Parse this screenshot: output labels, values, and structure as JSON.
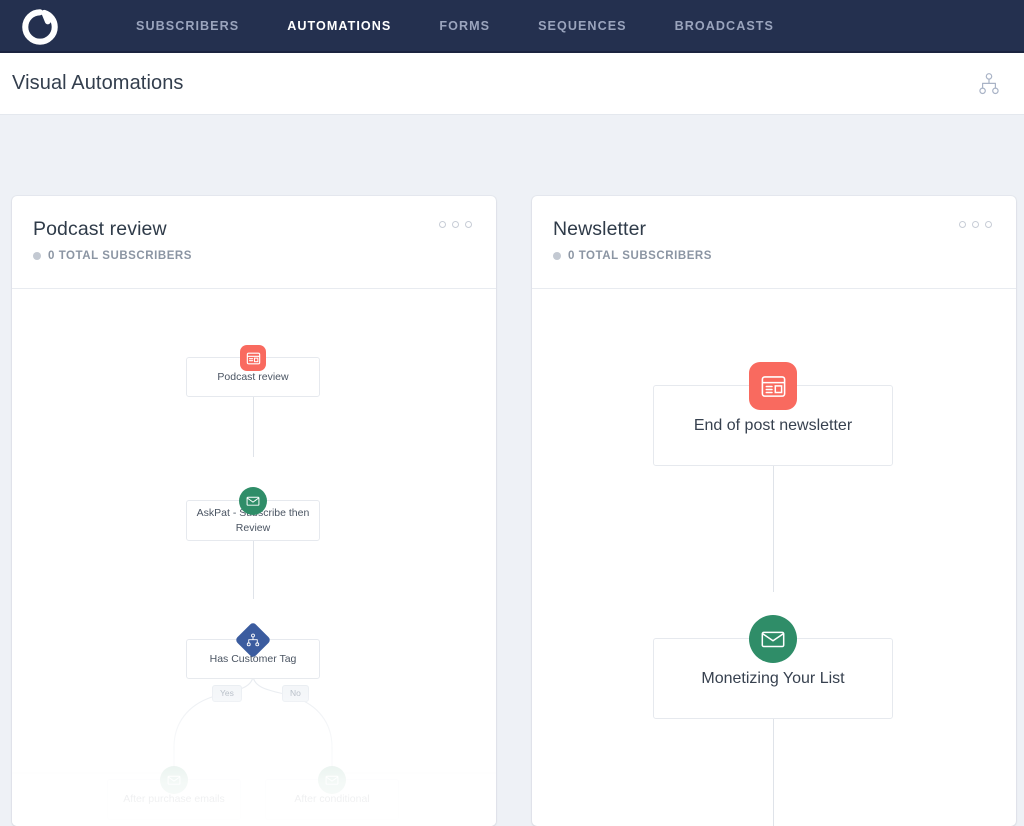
{
  "nav": {
    "logo_icon": "convertkit-logo-icon",
    "items": [
      {
        "label": "SUBSCRIBERS",
        "active": false
      },
      {
        "label": "AUTOMATIONS",
        "active": true
      },
      {
        "label": "FORMS",
        "active": false
      },
      {
        "label": "SEQUENCES",
        "active": false
      },
      {
        "label": "BROADCASTS",
        "active": false
      }
    ],
    "background": "#24304f",
    "active_color": "#ffffff",
    "inactive_color": "#9aa4bd"
  },
  "header": {
    "title": "Visual Automations",
    "tree_icon": "node-tree-icon"
  },
  "colors": {
    "page_background": "#eef1f6",
    "form_badge": "#f96a5f",
    "email_badge": "#2f8d68",
    "condition_badge": "#3b5c9f",
    "connector": "#dfe3e9"
  },
  "cards": [
    {
      "title": "Podcast review",
      "subscribers": "0 TOTAL SUBSCRIBERS",
      "menu_icon": "three-dots-icon",
      "nodes": [
        {
          "label": "Podcast review",
          "type": "form"
        },
        {
          "label": "AskPat - Subscribe then Review",
          "type": "email"
        },
        {
          "label": "Has Customer Tag",
          "type": "condition"
        },
        {
          "label": "After purchase emails",
          "type": "email"
        },
        {
          "label": "After conditional",
          "type": "email"
        }
      ],
      "branch_labels": [
        "Yes",
        "No"
      ]
    },
    {
      "title": "Newsletter",
      "subscribers": "0 TOTAL SUBSCRIBERS",
      "menu_icon": "three-dots-icon",
      "nodes": [
        {
          "label": "End of post newsletter",
          "type": "form"
        },
        {
          "label": "Monetizing Your List",
          "type": "email"
        }
      ],
      "branch_labels": []
    }
  ]
}
